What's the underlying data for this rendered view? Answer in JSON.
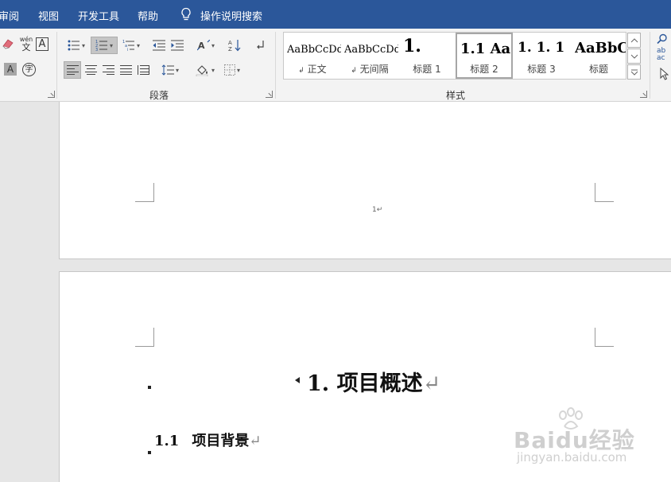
{
  "menu": {
    "tabs": [
      "审阅",
      "视图",
      "开发工具",
      "帮助"
    ],
    "search": "操作说明搜索"
  },
  "font_group": {
    "phonetic_top": "wén",
    "phonetic_bottom": "文",
    "char_border": "A",
    "char_shading": "A",
    "enclose_char": "字"
  },
  "paragraph_group": {
    "label": "段落"
  },
  "styles_group": {
    "label": "样式",
    "items": [
      {
        "preview": "AaBbCcDd",
        "name": "正文",
        "mark": "↲"
      },
      {
        "preview": "AaBbCcDd",
        "name": "无间隔",
        "mark": "↲"
      },
      {
        "preview": "1.",
        "name": "标题 1",
        "mark": ""
      },
      {
        "preview": "1.1  Aa",
        "name": "标题 2",
        "mark": ""
      },
      {
        "preview": "1. 1. 1",
        "name": "标题 3",
        "mark": ""
      },
      {
        "preview": "AaBbC",
        "name": "标题",
        "mark": ""
      }
    ]
  },
  "editing_group": {
    "replace_icon_text": "ab\nac"
  },
  "document": {
    "page1_number": "1↵",
    "heading1": "1.   项目概述",
    "heading2_num": "1.1",
    "heading2_text": "项目背景",
    "para_mark": "↵"
  },
  "watermark": {
    "logo": "Baidu经验",
    "url": "jingyan.baidu.com"
  },
  "colors": {
    "ribbon_blue": "#2b579a",
    "ribbon_bg": "#f3f3f3",
    "canvas_bg": "#e6e6e6"
  }
}
